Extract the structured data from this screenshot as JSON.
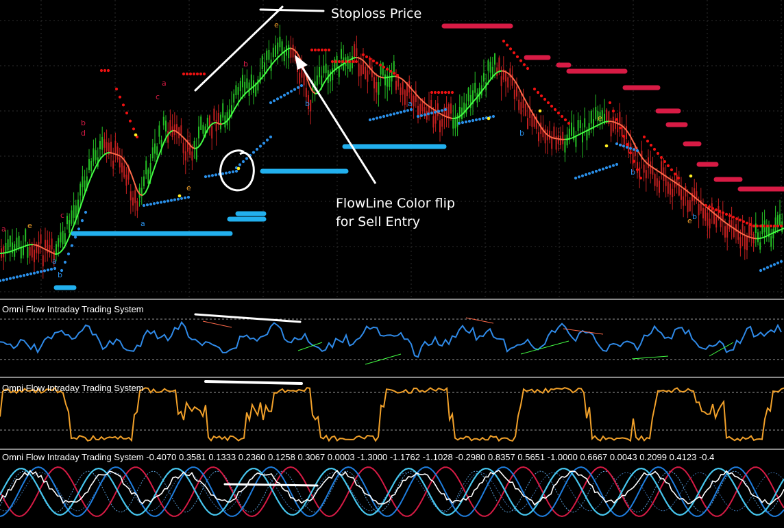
{
  "app": {
    "title": "Omni Flow Intraday Trading System chart"
  },
  "colors": {
    "background": "#000000",
    "grid": "#2e2e2e",
    "candle_bull": "#25c125",
    "candle_bear": "#c42020",
    "flowline_bull": "#44ff44",
    "flowline_bear": "#ff6a4a",
    "support_dots": "#2a8fe8",
    "resistance_dots": "#ee1111",
    "support_level": "#22b0ee",
    "resistance_level": "#d81b45",
    "oscillator_1": "#2f8ae8",
    "oscillator_2": "#f2a12a",
    "wave_red": "#d81b45",
    "wave_blue": "#1f7fe0",
    "wave_cyan": "#47c6ee",
    "wave_white": "#ffffff",
    "annotation": "#ffffff"
  },
  "annotations": {
    "stoploss": "Stoploss Price",
    "flowline_line1": "FlowLine Color flip",
    "flowline_line2": "for Sell Entry"
  },
  "panes": {
    "osc1_label": "Omni Flow Intraday Trading System",
    "osc2_label": "Omni Flow Intraday Trading System",
    "osc3_label": "Omni Flow Intraday Trading System -0.4070 0.3581 0.1333 0.2360 0.1258 0.3067 0.0003 -1.3000 -1.1762 -1.1028 -0.2980 0.8357 0.5651 -1.0000 0.6667 0.0043 0.2099 0.4123 -0.4"
  },
  "icons": [
    "wave-letter-marker",
    "signal-dot"
  ]
}
